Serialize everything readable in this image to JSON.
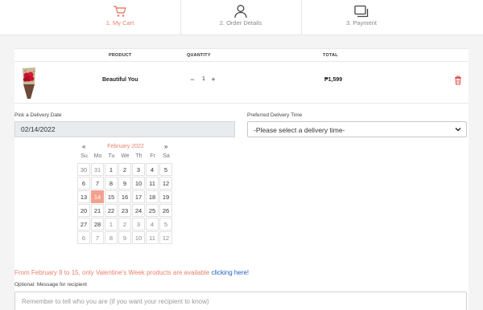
{
  "steps": [
    {
      "label": "1. My Cart",
      "icon": "cart-icon",
      "active": true
    },
    {
      "label": "2. Order Details",
      "icon": "user-icon",
      "active": false
    },
    {
      "label": "3. Payment",
      "icon": "card-icon",
      "active": false
    }
  ],
  "cart": {
    "headers": {
      "product": "PRODUCT",
      "quantity": "QUANTITY",
      "total": "TOTAL"
    },
    "item": {
      "name": "Beautiful You",
      "quantity": "1",
      "total": "₱1,599",
      "minus": "−",
      "plus": "+"
    }
  },
  "delivery": {
    "date_label": "Pick a Delivery Date",
    "date_value": "02/14/2022",
    "time_label": "Preferred Delivery Time",
    "time_value": "-Please select a delivery time-"
  },
  "calendar": {
    "prev": "«",
    "next": "»",
    "month": "February 2022",
    "weekdays": [
      "Su",
      "Mo",
      "Tu",
      "We",
      "Th",
      "Fr",
      "Sa"
    ],
    "weeks": [
      [
        "30",
        "31",
        "1",
        "2",
        "3",
        "4",
        "5"
      ],
      [
        "6",
        "7",
        "8",
        "9",
        "10",
        "11",
        "12"
      ],
      [
        "13",
        "14",
        "15",
        "16",
        "17",
        "18",
        "19"
      ],
      [
        "20",
        "21",
        "22",
        "23",
        "24",
        "25",
        "26"
      ],
      [
        "27",
        "28",
        "1",
        "2",
        "3",
        "4",
        "5"
      ],
      [
        "6",
        "7",
        "8",
        "9",
        "10",
        "11",
        "12"
      ]
    ],
    "selected": "14"
  },
  "notice": {
    "text": "From February 8 to 15, only Valentine's Week products are available ",
    "link": "clicking here!"
  },
  "message": {
    "label": "Optional: Message for recipient",
    "placeholder": "Remember to tell who you are (if you want your recipient to know)"
  },
  "colors": {
    "accent": "#e8826d",
    "selected_day": "#f4a08f",
    "link": "#2060c4"
  }
}
